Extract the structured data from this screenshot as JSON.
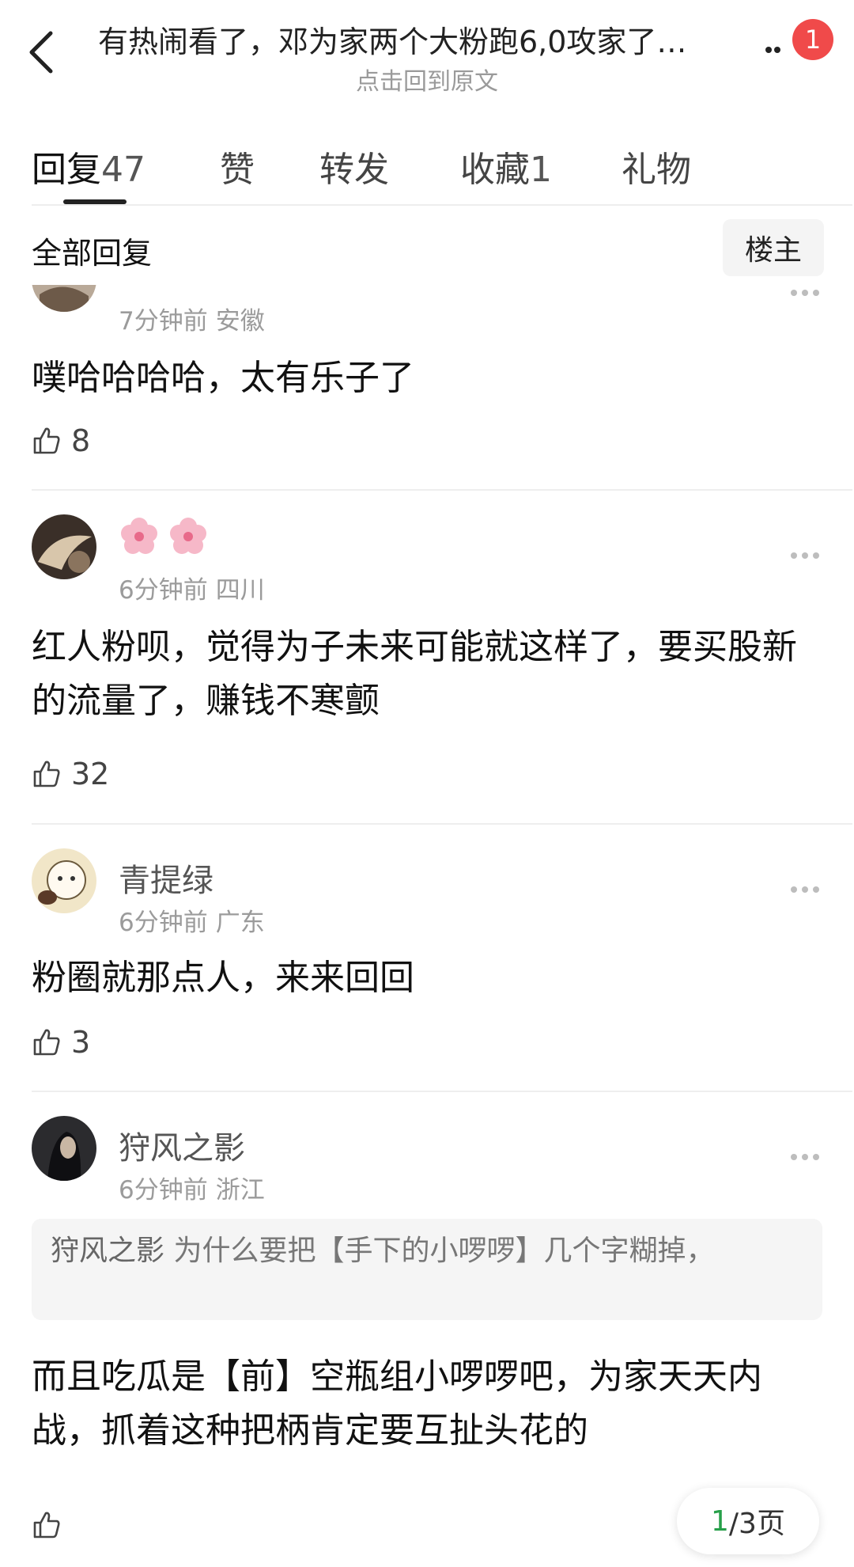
{
  "header": {
    "title": "有热闹看了，邓为家两个大粉跑6,0攻家了…",
    "subtitle": "点击回到原文",
    "badge": "1"
  },
  "tabs": [
    {
      "label": "回复",
      "count": "47"
    },
    {
      "label": "赞",
      "count": ""
    },
    {
      "label": "转发",
      "count": ""
    },
    {
      "label": "收藏",
      "count": "1"
    },
    {
      "label": "礼物",
      "count": ""
    }
  ],
  "section": {
    "title": "全部回复",
    "owner_label": "楼主"
  },
  "comments": [
    {
      "user": "",
      "time": "7分钟前",
      "location": "安徽",
      "text": "噗哈哈哈哈，太有乐子了",
      "likes": "8"
    },
    {
      "user": "🌸🌸",
      "time": "6分钟前",
      "location": "四川",
      "text": "红人粉呗，觉得为子未来可能就这样了，要买股新的流量了，赚钱不寒颤",
      "likes": "32"
    },
    {
      "user": "青提绿",
      "time": "6分钟前",
      "location": "广东",
      "text": "粉圈就那点人，来来回回",
      "likes": "3"
    },
    {
      "user": "狩风之影",
      "time": "6分钟前",
      "location": "浙江",
      "quote_name": "狩风之影",
      "quote_text": "为什么要把【手下的小啰啰】几个字糊掉，",
      "text": "而且吃瓜是【前】空瓶组小啰啰吧，为家天天内战，抓着这种把柄肯定要互扯头花的",
      "likes": ""
    }
  ],
  "pager": {
    "current": "1",
    "total_label": "/3页"
  },
  "colors": {
    "badge_red": "#f04a4a",
    "pager_green": "#27a04a"
  }
}
